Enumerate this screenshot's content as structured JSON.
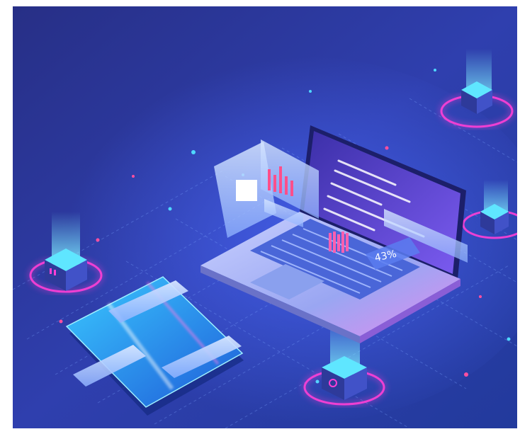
{
  "illustration": {
    "percent_label": "43%",
    "palette": {
      "bg_dark": "#1f2f82",
      "bg_mid": "#3446b8",
      "glow_blue": "#4fd8ff",
      "glow_pink": "#ff3fd6",
      "laptop_body": "#9fb0f5",
      "screen": "#5b4bd6"
    }
  }
}
